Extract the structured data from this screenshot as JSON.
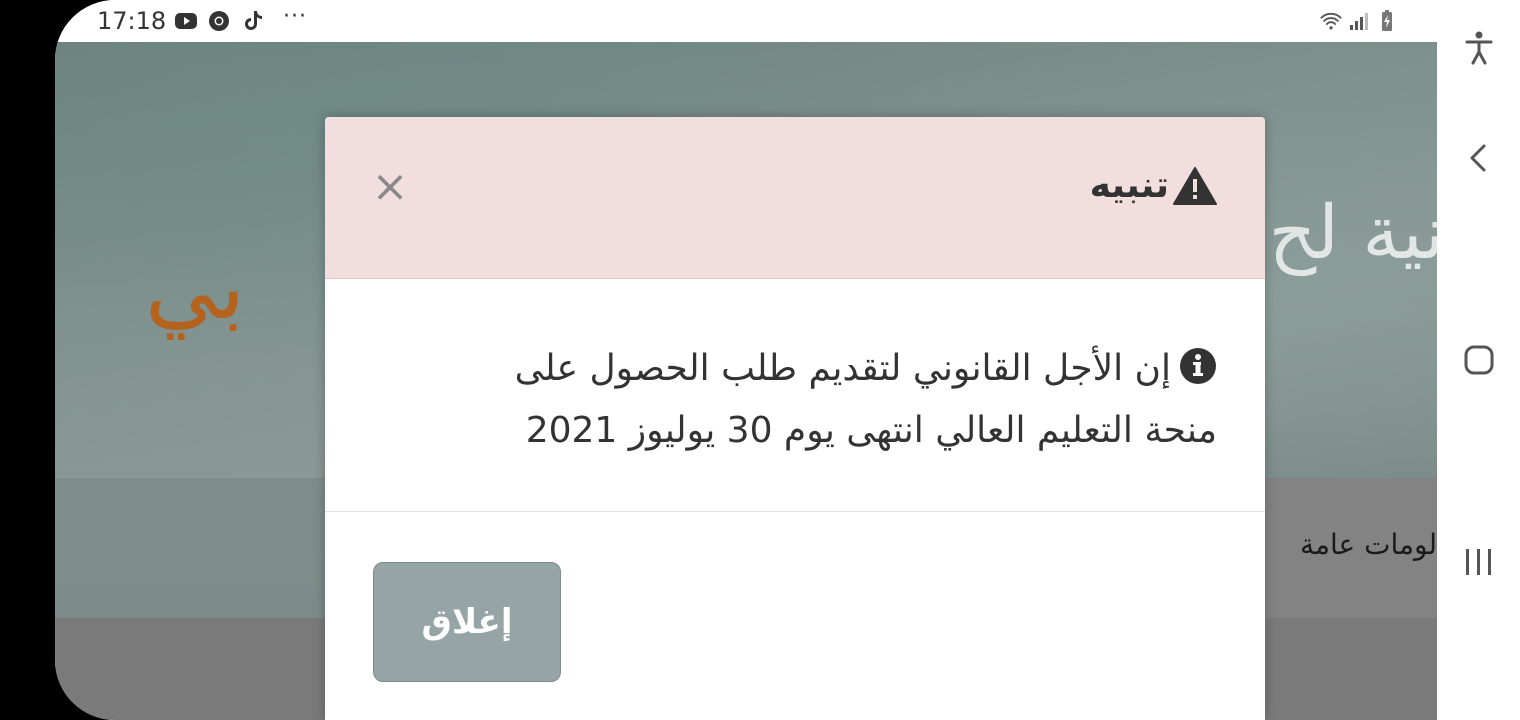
{
  "status_bar": {
    "time": "17:18",
    "more": "···",
    "icons": [
      "youtube-icon",
      "chrome-icon",
      "tiktok-icon",
      "wifi-icon",
      "signal-icon",
      "battery-icon"
    ]
  },
  "background_page": {
    "title_fragment": "نية لح",
    "orange_fragment": "بي",
    "info_fragment": "لومات عامة"
  },
  "modal": {
    "title": "تنبيه",
    "close_symbol": "×",
    "message": "إن الأجل القانوني لتقديم طلب الحصول على منحة التعليم العالي انتهى يوم 30 يوليوز 2021",
    "close_button_label": "إغلاق",
    "colors": {
      "header_bg": "#f2dede",
      "button_bg": "#95a5a6"
    }
  },
  "nav_bar": {
    "icons": [
      "accessibility-icon",
      "back-icon",
      "home-icon",
      "recents-icon"
    ]
  }
}
